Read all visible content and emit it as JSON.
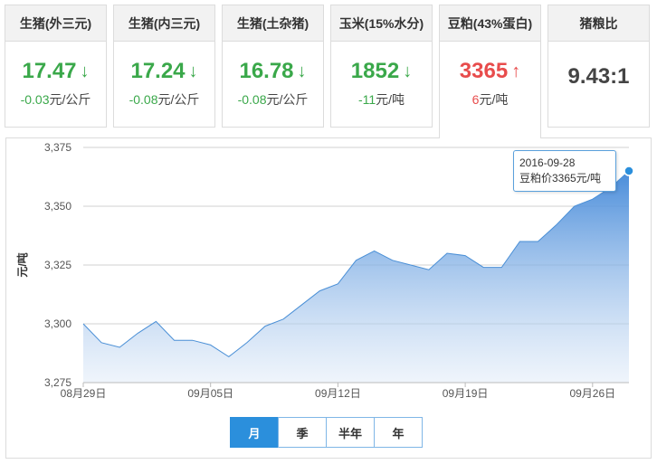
{
  "tabs": [
    {
      "title": "生猪(外三元)",
      "price": "17.47",
      "trend": "down",
      "change": "-0.03元/公斤"
    },
    {
      "title": "生猪(内三元)",
      "price": "17.24",
      "trend": "down",
      "change": "-0.08元/公斤"
    },
    {
      "title": "生猪(土杂猪)",
      "price": "16.78",
      "trend": "down",
      "change": "-0.08元/公斤"
    },
    {
      "title": "玉米(15%水分)",
      "price": "1852",
      "trend": "down",
      "change": "-11元/吨"
    },
    {
      "title": "豆粕(43%蛋白)",
      "price": "3365",
      "trend": "up",
      "change": "6元/吨"
    },
    {
      "title": "猪粮比",
      "price": "9.43:1",
      "trend": "none",
      "change": ""
    }
  ],
  "active_tab": 4,
  "colors": {
    "down": "#3aa84a",
    "up": "#e84c4c",
    "accent": "#2b8fdc",
    "line": "#4a8fd6"
  },
  "tooltip": {
    "date": "2016-09-28",
    "text": "豆粕价3365元/吨"
  },
  "range_buttons": [
    "月",
    "季",
    "半年",
    "年"
  ],
  "active_range": 0,
  "chart_data": {
    "type": "area",
    "ylabel": "元/吨",
    "ylim": [
      3275,
      3375
    ],
    "yticks": [
      3275,
      3300,
      3325,
      3350,
      3375
    ],
    "yticklabels": [
      "3,275",
      "3,300",
      "3,325",
      "3,350",
      "3,375"
    ],
    "xticklabels": [
      "08月29日",
      "09月05日",
      "09月12日",
      "09月19日",
      "09月26日"
    ],
    "grid": true,
    "legend": "none",
    "x": [
      "2016-08-29",
      "2016-08-30",
      "2016-08-31",
      "2016-09-01",
      "2016-09-02",
      "2016-09-03",
      "2016-09-04",
      "2016-09-05",
      "2016-09-06",
      "2016-09-07",
      "2016-09-08",
      "2016-09-09",
      "2016-09-10",
      "2016-09-11",
      "2016-09-12",
      "2016-09-13",
      "2016-09-14",
      "2016-09-15",
      "2016-09-16",
      "2016-09-17",
      "2016-09-18",
      "2016-09-19",
      "2016-09-20",
      "2016-09-21",
      "2016-09-22",
      "2016-09-23",
      "2016-09-24",
      "2016-09-25",
      "2016-09-26",
      "2016-09-27",
      "2016-09-28"
    ],
    "values": [
      3300,
      3292,
      3290,
      3296,
      3301,
      3293,
      3293,
      3291,
      3286,
      3292,
      3299,
      3302,
      3308,
      3314,
      3317,
      3327,
      3331,
      3327,
      3325,
      3323,
      3330,
      3329,
      3324,
      3324,
      3335,
      3335,
      3342,
      3350,
      3353,
      3358,
      3365
    ]
  }
}
